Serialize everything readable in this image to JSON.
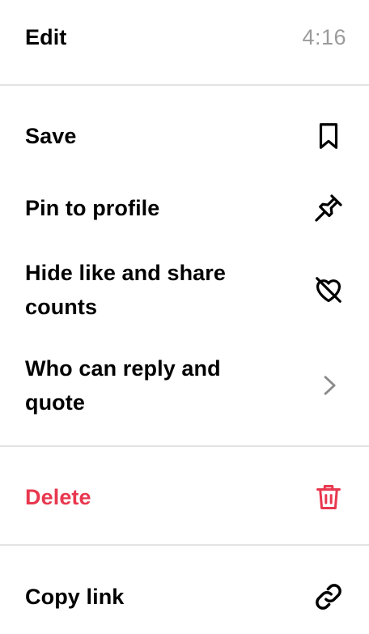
{
  "header": {
    "edit_label": "Edit",
    "time": "4:16"
  },
  "menu": {
    "save_label": "Save",
    "save_icon": "bookmark-icon",
    "pin_label": "Pin to profile",
    "pin_icon": "pin-icon",
    "hide_counts_label": "Hide like and share counts",
    "hide_counts_icon": "heart-off-icon",
    "reply_quote_label": "Who can reply and quote",
    "reply_quote_icon": "chevron-right-icon",
    "delete_label": "Delete",
    "delete_icon": "trash-icon",
    "copy_link_label": "Copy link",
    "copy_link_icon": "link-icon"
  },
  "colors": {
    "text": "#000000",
    "secondary_text": "#9b9b9b",
    "destructive": "#e8384f",
    "divider": "#e3e3e3",
    "chevron": "#8a8a8a"
  }
}
